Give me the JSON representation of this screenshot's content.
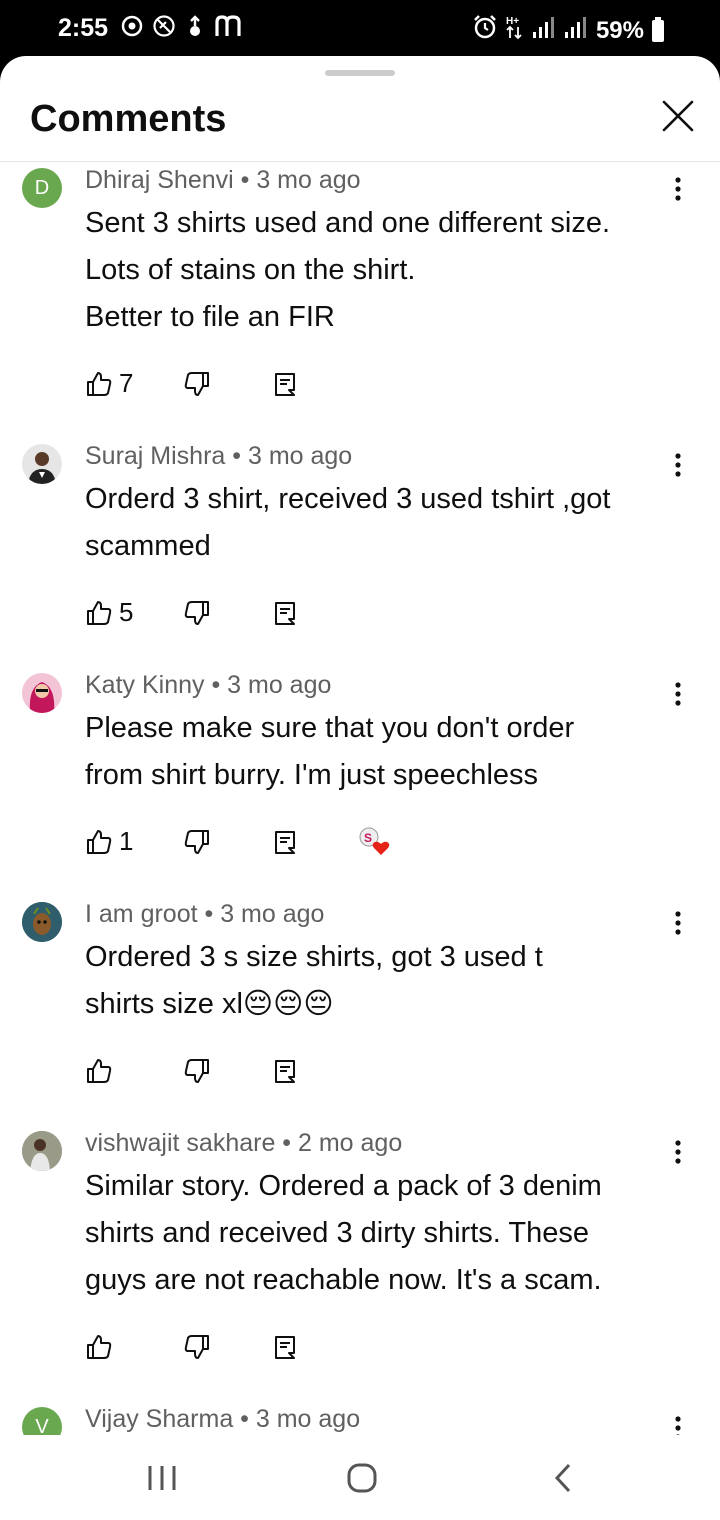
{
  "status_bar": {
    "time": "2:55",
    "battery": "59%",
    "left_icons": [
      "headset-icon",
      "vpn-icon",
      "usb-icon",
      "mail-icon"
    ],
    "right_icons": [
      "alarm-icon",
      "data-icon",
      "signal-icon",
      "signal-icon",
      "battery-icon"
    ]
  },
  "sheet": {
    "title": "Comments"
  },
  "comments": [
    {
      "author_time": "Dhiraj Shenvi • 3 mo ago",
      "avatar_letter": "D",
      "avatar_color": "#6aa84f",
      "lines": [
        "Sent 3 shirts used and one different size.",
        "Lots of stains on the shirt.",
        "Better to file an FIR"
      ],
      "likes": "7"
    },
    {
      "author_time": "Suraj Mishra • 3 mo ago",
      "avatar_letter": "",
      "avatar_color": "#d8d8d8",
      "lines": [
        "Orderd 3 shirt, received 3 used tshirt ,got",
        "scammed"
      ],
      "likes": "5"
    },
    {
      "author_time": "Katy Kinny • 3 mo ago",
      "avatar_letter": "",
      "avatar_color": "#c2185b",
      "lines": [
        "Please make sure that you don't order",
        "from shirt burry. I'm just speechless"
      ],
      "likes": "1",
      "creator_heart": true
    },
    {
      "author_time": "I am groot • 3 mo ago",
      "avatar_letter": "",
      "avatar_color": "#3c6e71",
      "lines": [
        "Ordered 3 s size shirts, got 3 used t",
        "shirts size xl😔😔😔"
      ],
      "likes": ""
    },
    {
      "author_time": "vishwajit sakhare • 2 mo ago",
      "avatar_letter": "",
      "avatar_color": "#7a7a6a",
      "lines": [
        "Similar story. Ordered a pack of 3 denim",
        "shirts and received 3 dirty shirts. These",
        "guys are not reachable now. It's a scam."
      ],
      "likes": ""
    },
    {
      "author_time": "Vijay Sharma • 3 mo ago",
      "avatar_letter": "V",
      "avatar_color": "#6aa84f",
      "lines": [],
      "likes": ""
    }
  ]
}
